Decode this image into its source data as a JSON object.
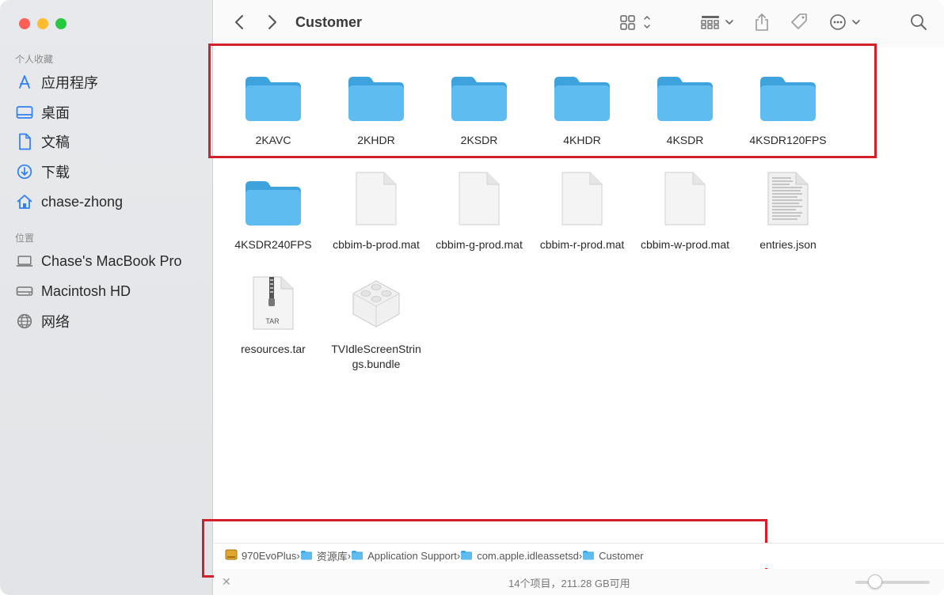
{
  "window": {
    "title": "Customer"
  },
  "sidebar": {
    "section_favorites": "个人收藏",
    "section_locations": "位置",
    "favorites": [
      {
        "label": "应用程序",
        "icon": "applications-icon"
      },
      {
        "label": "桌面",
        "icon": "desktop-icon"
      },
      {
        "label": "文稿",
        "icon": "document-icon"
      },
      {
        "label": "下载",
        "icon": "download-icon"
      },
      {
        "label": "chase-zhong",
        "icon": "home-icon"
      }
    ],
    "locations": [
      {
        "label": "Chase's MacBook Pro",
        "icon": "laptop-icon"
      },
      {
        "label": "Macintosh HD",
        "icon": "drive-icon"
      },
      {
        "label": "网络",
        "icon": "network-icon"
      }
    ]
  },
  "files": [
    {
      "name": "2KAVC",
      "kind": "folder"
    },
    {
      "name": "2KHDR",
      "kind": "folder"
    },
    {
      "name": "2KSDR",
      "kind": "folder"
    },
    {
      "name": "4KHDR",
      "kind": "folder"
    },
    {
      "name": "4KSDR",
      "kind": "folder"
    },
    {
      "name": "4KSDR120FPS",
      "kind": "folder"
    },
    {
      "name": "4KSDR240FPS",
      "kind": "folder"
    },
    {
      "name": "cbbim-b-prod.mat",
      "kind": "doc"
    },
    {
      "name": "cbbim-g-prod.mat",
      "kind": "doc"
    },
    {
      "name": "cbbim-r-prod.mat",
      "kind": "doc"
    },
    {
      "name": "cbbim-w-prod.mat",
      "kind": "doc"
    },
    {
      "name": "entries.json",
      "kind": "json"
    },
    {
      "name": "resources.tar",
      "kind": "tar",
      "badge": "TAR"
    },
    {
      "name": "TVIdleScreenStrings.bundle",
      "kind": "bundle"
    }
  ],
  "pathbar": [
    {
      "label": "970EvoPlus",
      "icon": "external-drive-icon"
    },
    {
      "label": "资源库",
      "icon": "folder-icon"
    },
    {
      "label": "Application Support",
      "icon": "folder-icon"
    },
    {
      "label": "com.apple.idleassetsd",
      "icon": "folder-icon"
    },
    {
      "label": "Customer",
      "icon": "folder-icon"
    }
  ],
  "status": {
    "text": "14个项目，211.28 GB可用"
  },
  "colors": {
    "folder": "#5fbcf0",
    "folder_tab": "#3ea3dd",
    "accent": "#2f7ff6",
    "highlight": "#d4202a"
  }
}
